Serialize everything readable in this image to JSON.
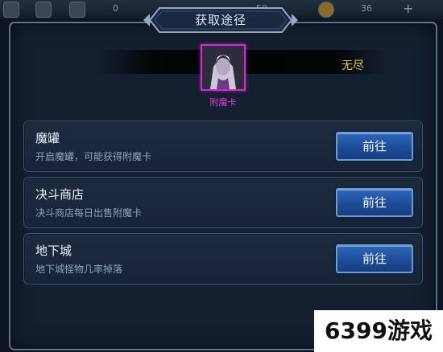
{
  "hud": {
    "values": [
      "0",
      "50",
      "36",
      "+"
    ]
  },
  "dialog": {
    "title": "获取途径",
    "duration_text": "无尽",
    "card_name": "附魔卡"
  },
  "sources": [
    {
      "title": "魔罐",
      "desc": "开启魔罐，可能获得附魔卡",
      "button": "前往"
    },
    {
      "title": "决斗商店",
      "desc": "决斗商店每日出售附魔卡",
      "button": "前往"
    },
    {
      "title": "地下城",
      "desc": "地下城怪物几率掉落",
      "button": "前往"
    }
  ],
  "watermark": "6399游戏",
  "colors": {
    "accent_gold": "#e8c85a",
    "card_magenta": "#d02ad0",
    "button_blue": "#1e4c98"
  },
  "icons": [
    "card-portrait",
    "hud-item-icon"
  ]
}
